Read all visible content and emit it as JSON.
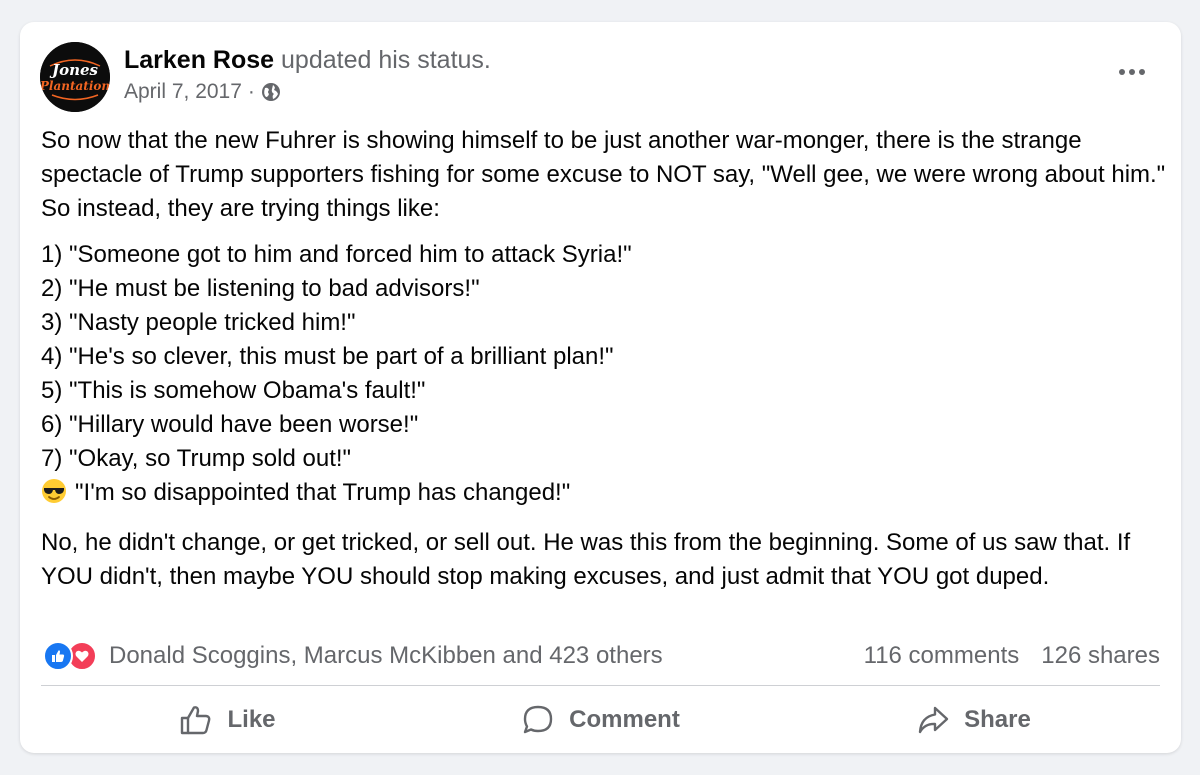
{
  "post": {
    "author": "Larken Rose",
    "action": "updated his status.",
    "date": "April 7, 2017",
    "separator": "·",
    "avatar_icon": "jones-plantation-logo",
    "avatar_text_top": "Jones",
    "avatar_text_bottom": "Plantation",
    "privacy_icon": "globe-icon",
    "body": {
      "intro": "So now that the new Fuhrer is showing himself to be just another war-monger, there is the strange spectacle of Trump supporters fishing for some excuse to NOT say, \"Well gee, we were wrong about him.\" So instead, they are trying things like:",
      "list": [
        "1) \"Someone got to him and forced him to attack Syria!\"",
        "2) \"He must be listening to bad advisors!\"",
        "3) \"Nasty people tricked him!\"",
        "4) \"He's so clever, this must be part of a brilliant plan!\"",
        "5) \"This is somehow Obama's fault!\"",
        "6) \"Hillary would have been worse!\"",
        "7) \"Okay, so Trump sold out!\"",
        "\"I'm so disappointed that Trump has changed!\""
      ],
      "last_item_emoji": "smiling-face-with-sunglasses-emoji",
      "closing": "No, he didn't change, or get tricked, or sell out. He was this from the beginning. Some of us saw that. If YOU didn't, then maybe YOU should stop making excuses, and just admit that YOU got duped."
    }
  },
  "engagement": {
    "reactions_text": "Donald Scoggins, Marcus McKibben and 423 others",
    "reaction_icons": [
      "like-reaction-icon",
      "love-reaction-icon"
    ],
    "comments": "116 comments",
    "shares": "126 shares"
  },
  "actions": {
    "like": "Like",
    "comment": "Comment",
    "share": "Share"
  },
  "colors": {
    "background": "#f0f2f5",
    "card": "#ffffff",
    "secondary_text": "#65676b",
    "like_blue": "#1877f2",
    "love_red": "#f33e58",
    "avatar_orange": "#f26522"
  }
}
